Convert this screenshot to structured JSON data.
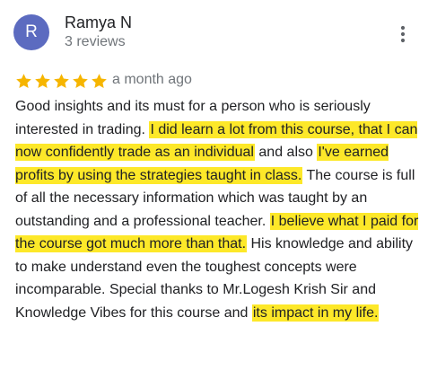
{
  "review": {
    "avatar_letter": "R",
    "avatar_color": "#5c6bc0",
    "reviewer_name": "Ramya N",
    "review_count": "3 reviews",
    "rating": 5,
    "rating_max": 5,
    "star_color": "#f6b500",
    "date": "a month ago",
    "highlight_color": "#fde829",
    "text": {
      "p1": "Good insights and its must for a person who is seriously interested in trading.",
      "h1": "I did learn a lot from this course, that I can now confidently trade as an individual",
      "p2": "and also",
      "h2": "I've earned profits by using the strategies taught in class.",
      "p3": "The course is full of all the necessary information which was taught by an outstanding and a professional teacher.",
      "h3": "I believe what I paid for the course got much more than that.",
      "p4": "His knowledge and ability to make understand even the toughest concepts were incomparable. Special thanks to  Mr.Logesh Krish Sir and Knowledge Vibes for this course and",
      "h4": "its impact in my life."
    }
  },
  "icons": {
    "more": "more-vert-icon",
    "star": "star-icon"
  }
}
